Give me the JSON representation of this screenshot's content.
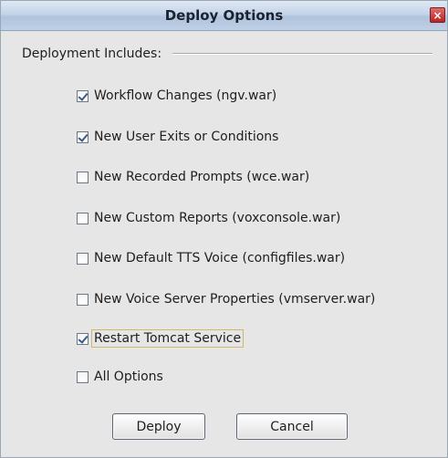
{
  "dialog": {
    "title": "Deploy Options",
    "close_glyph": "×"
  },
  "group": {
    "label": "Deployment Includes:"
  },
  "options": [
    {
      "label": "Workflow Changes (ngv.war)",
      "checked": true
    },
    {
      "label": "New User Exits or Conditions",
      "checked": true
    },
    {
      "label": "New Recorded Prompts (wce.war)",
      "checked": false
    },
    {
      "label": "New Custom Reports (voxconsole.war)",
      "checked": false
    },
    {
      "label": "New Default TTS Voice (configfiles.war)",
      "checked": false
    },
    {
      "label": "New Voice Server Properties (vmserver.war)",
      "checked": false
    },
    {
      "label": "Restart Tomcat Service",
      "checked": true,
      "focused": true
    },
    {
      "label": "All Options",
      "checked": false
    }
  ],
  "buttons": {
    "deploy_label": "Deploy",
    "cancel_label": "Cancel"
  },
  "icons": {
    "close": "close-icon",
    "checkbox": "checkbox-icon"
  },
  "colors": {
    "titlebar": "#c4d4e8",
    "close_button": "#c83a3a",
    "dialog_background": "#e6e6e6",
    "checkmark": "#3a5a86"
  }
}
